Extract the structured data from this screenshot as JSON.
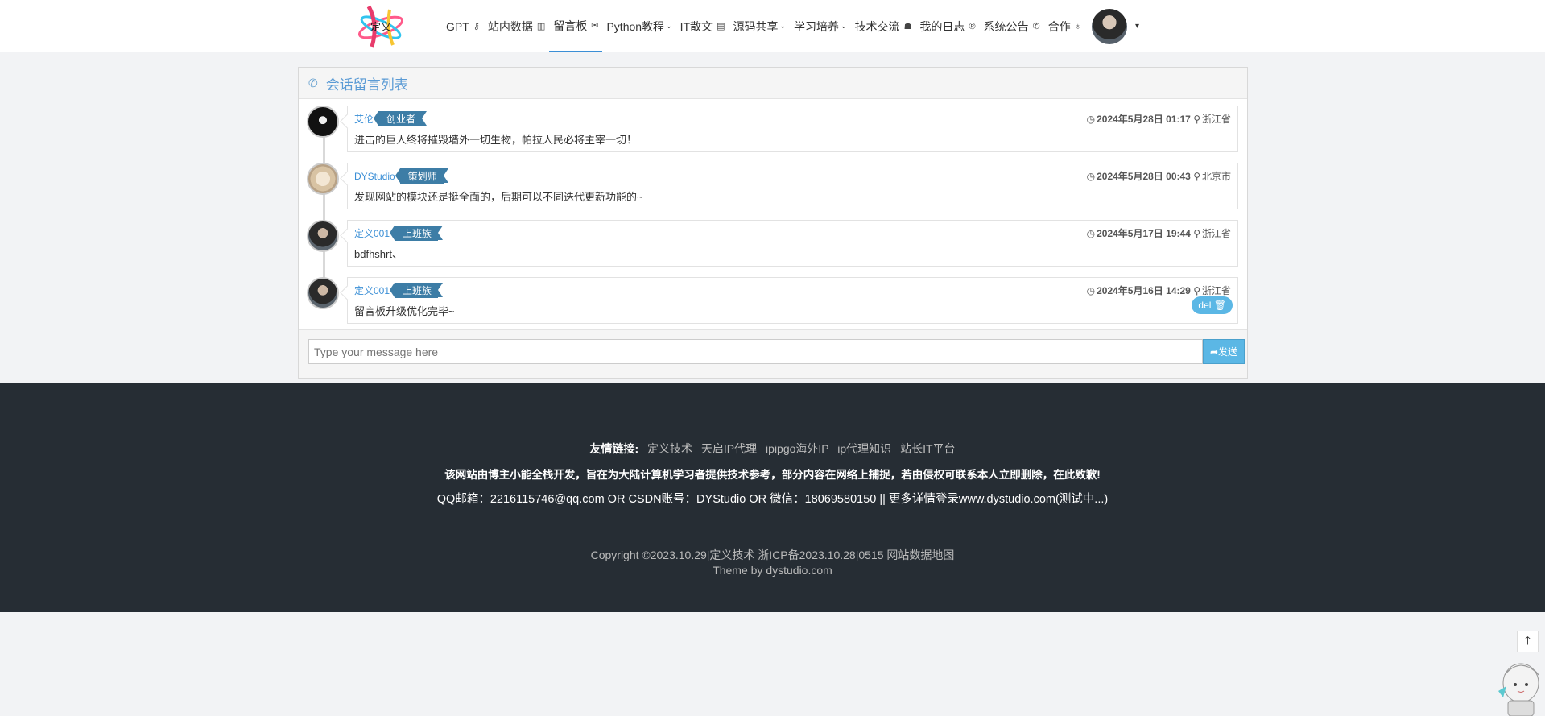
{
  "nav": {
    "logo_text": "定义",
    "items": [
      {
        "label": "GPT",
        "icon": "⚷"
      },
      {
        "label": "站内数据",
        "icon": "▥"
      },
      {
        "label": "留言板",
        "icon": "✉"
      },
      {
        "label": "Python教程",
        "icon": "⌄"
      },
      {
        "label": "IT散文",
        "icon": "▤"
      },
      {
        "label": "源码共享",
        "icon": "⌄"
      },
      {
        "label": "学习培养",
        "icon": "⌄"
      },
      {
        "label": "技术交流",
        "icon": "☗"
      },
      {
        "label": "我的日志",
        "icon": "℗"
      },
      {
        "label": "系统公告",
        "icon": "✆"
      },
      {
        "label": "合作",
        "icon": "♁"
      }
    ],
    "avatar_caret": "▾"
  },
  "panel": {
    "title": "会话留言列表",
    "title_icon": "✆"
  },
  "messages": [
    {
      "name": "艾伦",
      "badge": "创业者",
      "time": "2024年5月28日 01:17",
      "location": "浙江省",
      "text": "进击的巨人终将摧毁墙外一切生物，帕拉人民必将主宰一切！"
    },
    {
      "name": "DYStudio",
      "badge": "策划师",
      "time": "2024年5月28日 00:43",
      "location": "北京市",
      "text": "发现网站的模块还是挺全面的，后期可以不同迭代更新功能的~"
    },
    {
      "name": "定义001",
      "badge": "上班族",
      "time": "2024年5月17日 19:44",
      "location": "浙江省",
      "text": "bdfhshrt、"
    },
    {
      "name": "定义001",
      "badge": "上班族",
      "time": "2024年5月16日 14:29",
      "location": "浙江省",
      "text": "留言板升级优化完毕~",
      "del": "del 🗑"
    }
  ],
  "input": {
    "placeholder": "Type your message here",
    "send_label": "发送",
    "send_icon": "➦"
  },
  "footer": {
    "links_label": "友情链接:",
    "links": [
      "定义技术",
      "天启IP代理",
      "ipipgo海外IP",
      "ip代理知识",
      "站长IT平台"
    ],
    "disclaimer": "该网站由博主小能全栈开发，旨在为大陆计算机学习者提供技术参考，部分内容在网络上捕捉，若由侵权可联系本人立即删除，在此致歉!",
    "contact": "QQ邮箱：2216115746@qq.com OR CSDN账号：DYStudio OR 微信：18069580150     ||    更多详情登录www.dystudio.com(测试中...)",
    "copyright": "Copyright ©2023.10.29|定义技术  浙ICP备2023.10.28|0515   网站数据地图",
    "theme": "Theme by dystudio.com"
  },
  "back_top_icon": "🡑"
}
